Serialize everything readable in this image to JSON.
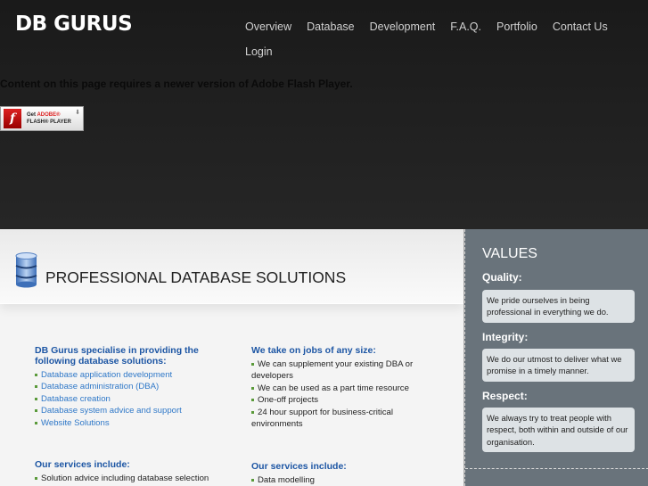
{
  "header": {
    "logo": "DB GURUS",
    "nav": [
      "Overview",
      "Database",
      "Development",
      "F.A.Q.",
      "Portfolio",
      "Contact Us",
      "Login"
    ]
  },
  "flash": {
    "message": "Content on this page requires a newer version of Adobe Flash Player.",
    "badge_get": "Get",
    "badge_adobe": "ADOBE®",
    "badge_player": "FLASH® PLAYER"
  },
  "main": {
    "title": "PROFESSIONAL DATABASE SOLUTIONS",
    "col1": {
      "heading": "DB Gurus specialise in providing the following database solutions:",
      "items": [
        "Database application development",
        "Database administration (DBA)",
        "Database creation",
        "Database system advice and support",
        "Website Solutions"
      ]
    },
    "col2": {
      "heading": "We take on jobs of any size:",
      "items": [
        "We can supplement your existing DBA or developers",
        "We can be used as a part time resource",
        "One-off projects",
        "24 hour support for business-critical environments"
      ]
    },
    "col3": {
      "heading": "Our services include:",
      "items": [
        "Solution advice including database selection"
      ]
    },
    "col4": {
      "heading": "Our services include:",
      "items": [
        "Data modelling"
      ]
    }
  },
  "values": {
    "title": "VALUES",
    "items": [
      {
        "label": "Quality:",
        "text": "We pride ourselves in being professional in everything we do."
      },
      {
        "label": "Integrity:",
        "text": "We do our utmost to deliver what we promise in a timely manner."
      },
      {
        "label": "Respect:",
        "text": "We always try to treat people with respect, both within and outside of our organisation."
      }
    ]
  }
}
